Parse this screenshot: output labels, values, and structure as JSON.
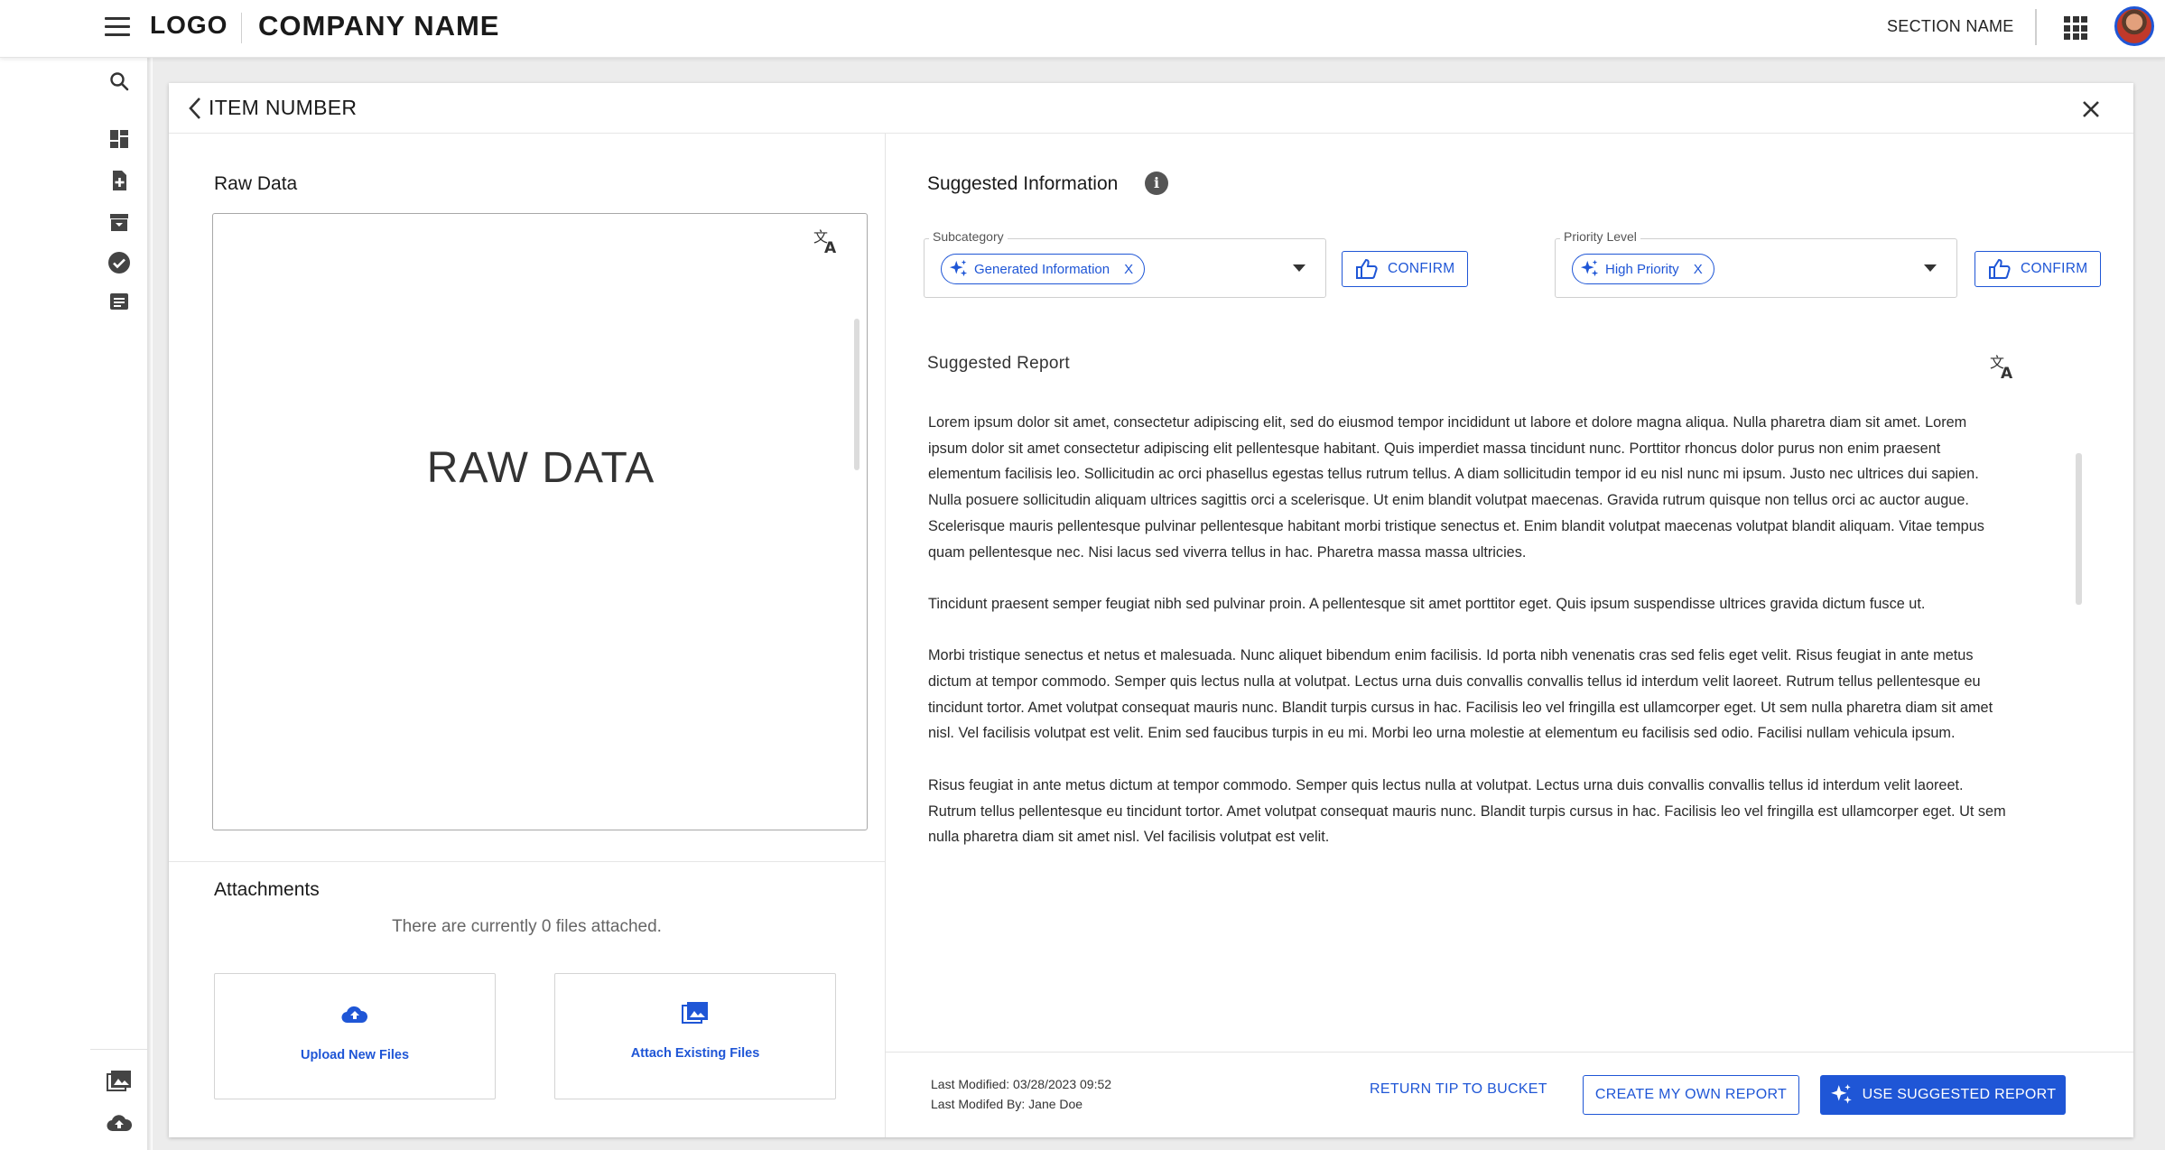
{
  "header": {
    "logo": "LOGO",
    "company_name": "COMPANY NAME",
    "section_name": "SECTION NAME"
  },
  "sidebar": {
    "icons": [
      "search-icon",
      "dashboard-icon",
      "add-document-icon",
      "archive-icon",
      "check-circle-icon",
      "message-icon",
      "photo-library-icon",
      "cloud-upload-icon"
    ]
  },
  "card": {
    "title": "ITEM NUMBER",
    "raw_data": {
      "title": "Raw Data",
      "content": "RAW DATA"
    },
    "attachments": {
      "title": "Attachments",
      "empty_text": "There are currently 0 files attached.",
      "upload_label": "Upload New Files",
      "attach_label": "Attach Existing Files"
    },
    "suggested": {
      "title": "Suggested Information",
      "subcategory": {
        "label": "Subcategory",
        "chip": "Generated Information",
        "chip_remove": "X",
        "confirm": "CONFIRM"
      },
      "priority": {
        "label": "Priority Level",
        "chip": "High Priority",
        "chip_remove": "X",
        "confirm": "CONFIRM"
      },
      "report_title": "Suggested Report",
      "report_paragraphs": [
        "Lorem ipsum dolor sit amet, consectetur adipiscing elit, sed do eiusmod tempor incididunt ut labore et dolore magna aliqua. Nulla pharetra diam sit amet. Lorem ipsum dolor sit amet consectetur adipiscing elit pellentesque habitant. Quis imperdiet massa tincidunt nunc. Porttitor rhoncus dolor purus non enim praesent elementum facilisis leo. Sollicitudin ac orci phasellus egestas tellus rutrum tellus. A diam sollicitudin tempor id eu nisl nunc mi ipsum. Justo nec ultrices dui sapien. Nulla posuere sollicitudin aliquam ultrices sagittis orci a scelerisque. Ut enim blandit volutpat maecenas. Gravida rutrum quisque non tellus orci ac auctor augue. Scelerisque mauris pellentesque pulvinar pellentesque habitant morbi tristique senectus et. Enim blandit volutpat maecenas volutpat blandit aliquam. Vitae tempus quam pellentesque nec. Nisi lacus sed viverra tellus in hac. Pharetra massa massa ultricies.",
        "Tincidunt praesent semper feugiat nibh sed pulvinar proin. A pellentesque sit amet porttitor eget. Quis ipsum suspendisse ultrices gravida dictum fusce ut.",
        "Morbi tristique senectus et netus et malesuada. Nunc aliquet bibendum enim facilisis. Id porta nibh venenatis cras sed felis eget velit. Risus feugiat in ante metus dictum at tempor commodo. Semper quis lectus nulla at volutpat. Lectus urna duis convallis convallis tellus id interdum velit laoreet. Rutrum tellus pellentesque eu tincidunt tortor. Amet volutpat consequat mauris nunc. Blandit turpis cursus in hac. Facilisis leo vel fringilla est ullamcorper eget. Ut sem nulla pharetra diam sit amet nisl. Vel facilisis volutpat est velit. Enim sed faucibus turpis in eu mi. Morbi leo urna molestie at elementum eu facilisis sed odio. Facilisi nullam vehicula ipsum.",
        "Risus feugiat in ante metus dictum at tempor commodo. Semper quis lectus nulla at volutpat. Lectus urna duis convallis convallis tellus id interdum velit laoreet. Rutrum tellus pellentesque eu tincidunt tortor. Amet volutpat consequat mauris nunc. Blandit turpis cursus in hac. Facilisis leo vel fringilla est ullamcorper eget. Ut sem nulla pharetra diam sit amet nisl. Vel facilisis volutpat est velit."
      ]
    },
    "footer": {
      "last_modified": "Last Modified: 03/28/2023 09:52",
      "last_modified_by": "Last Modifed By: Jane Doe",
      "return_label": "RETURN TIP TO BUCKET",
      "create_label": "CREATE MY OWN REPORT",
      "use_label": "USE SUGGESTED REPORT"
    }
  },
  "colors": {
    "accent": "#1f56d6",
    "background": "#ececec"
  }
}
